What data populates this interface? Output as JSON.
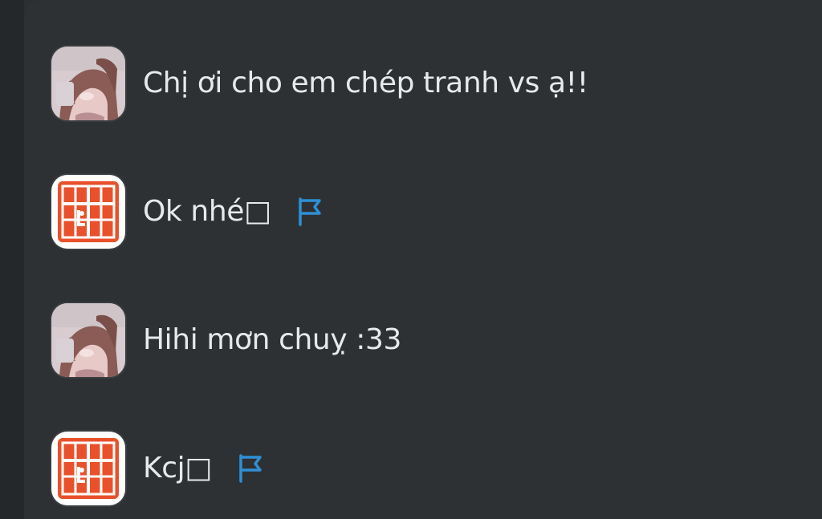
{
  "chat": {
    "messages": [
      {
        "avatar": "girl-portrait-avatar",
        "text": "Chị ơi cho em chép tranh vs ạ!!",
        "has_flag": false
      },
      {
        "avatar": "red-logo-avatar",
        "text": "Ok nhé□",
        "has_flag": true
      },
      {
        "avatar": "girl-portrait-avatar",
        "text": "Hihi mơn chuỵ :33",
        "has_flag": false
      },
      {
        "avatar": "red-logo-avatar",
        "text": "Kcj□",
        "has_flag": true
      }
    ]
  },
  "icons": {
    "flag": "flag-icon"
  },
  "colors": {
    "background": "#2b2f31",
    "panel": "#2d3133",
    "text": "#e7eaeb",
    "flag_blue": "#2f8fd6",
    "logo_red": "#e8512b"
  }
}
